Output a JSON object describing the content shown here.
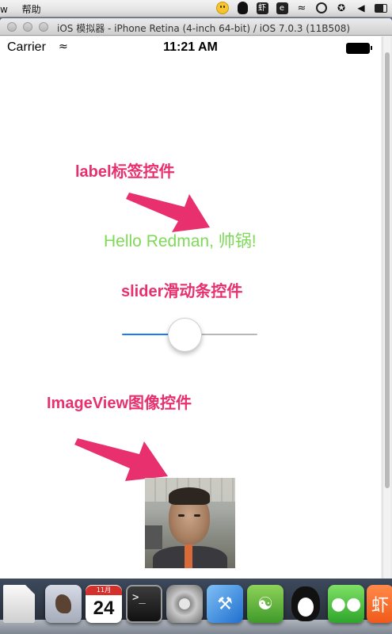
{
  "menubar": {
    "items": [
      "w",
      "帮助"
    ],
    "tray_icons": [
      "emoji-face-icon",
      "qq-penguin-icon",
      "shrimp-box-icon",
      "evernote-icon",
      "wifi-icon",
      "time-machine-icon",
      "bluetooth-icon",
      "volume-icon",
      "battery-icon"
    ],
    "xia_label": "虾"
  },
  "simulator": {
    "window_title": "iOS 模拟器 - iPhone Retina (4-inch 64-bit) / iOS 7.0.3 (11B508)"
  },
  "statusbar": {
    "carrier": "Carrier",
    "wifi": "wifi-icon",
    "time": "11:21 AM",
    "battery": "battery-full-icon"
  },
  "app": {
    "annotation_label": "label标签控件",
    "label_text": "Hello Redman, 帅锅!",
    "label_color": "#7ed957",
    "annotation_slider": "slider滑动条控件",
    "slider_value": 0.45,
    "slider_min_color": "#1a7cf5",
    "slider_max_color": "#b7b7b7",
    "annotation_imageview": "ImageView图像控件",
    "annotation_color": "#e8306e",
    "image": "portrait-photo"
  },
  "dock": {
    "items": [
      "document-icon",
      "mail-icon",
      "calendar-icon",
      "terminal-icon",
      "system-preferences-icon",
      "xcode-icon",
      "evernote-icon",
      "qq-icon",
      "wechat-icon",
      "xiami-icon"
    ],
    "calendar_day": "24",
    "calendar_month": "11月",
    "terminal_prompt": ">_",
    "xia_label": "虾"
  }
}
